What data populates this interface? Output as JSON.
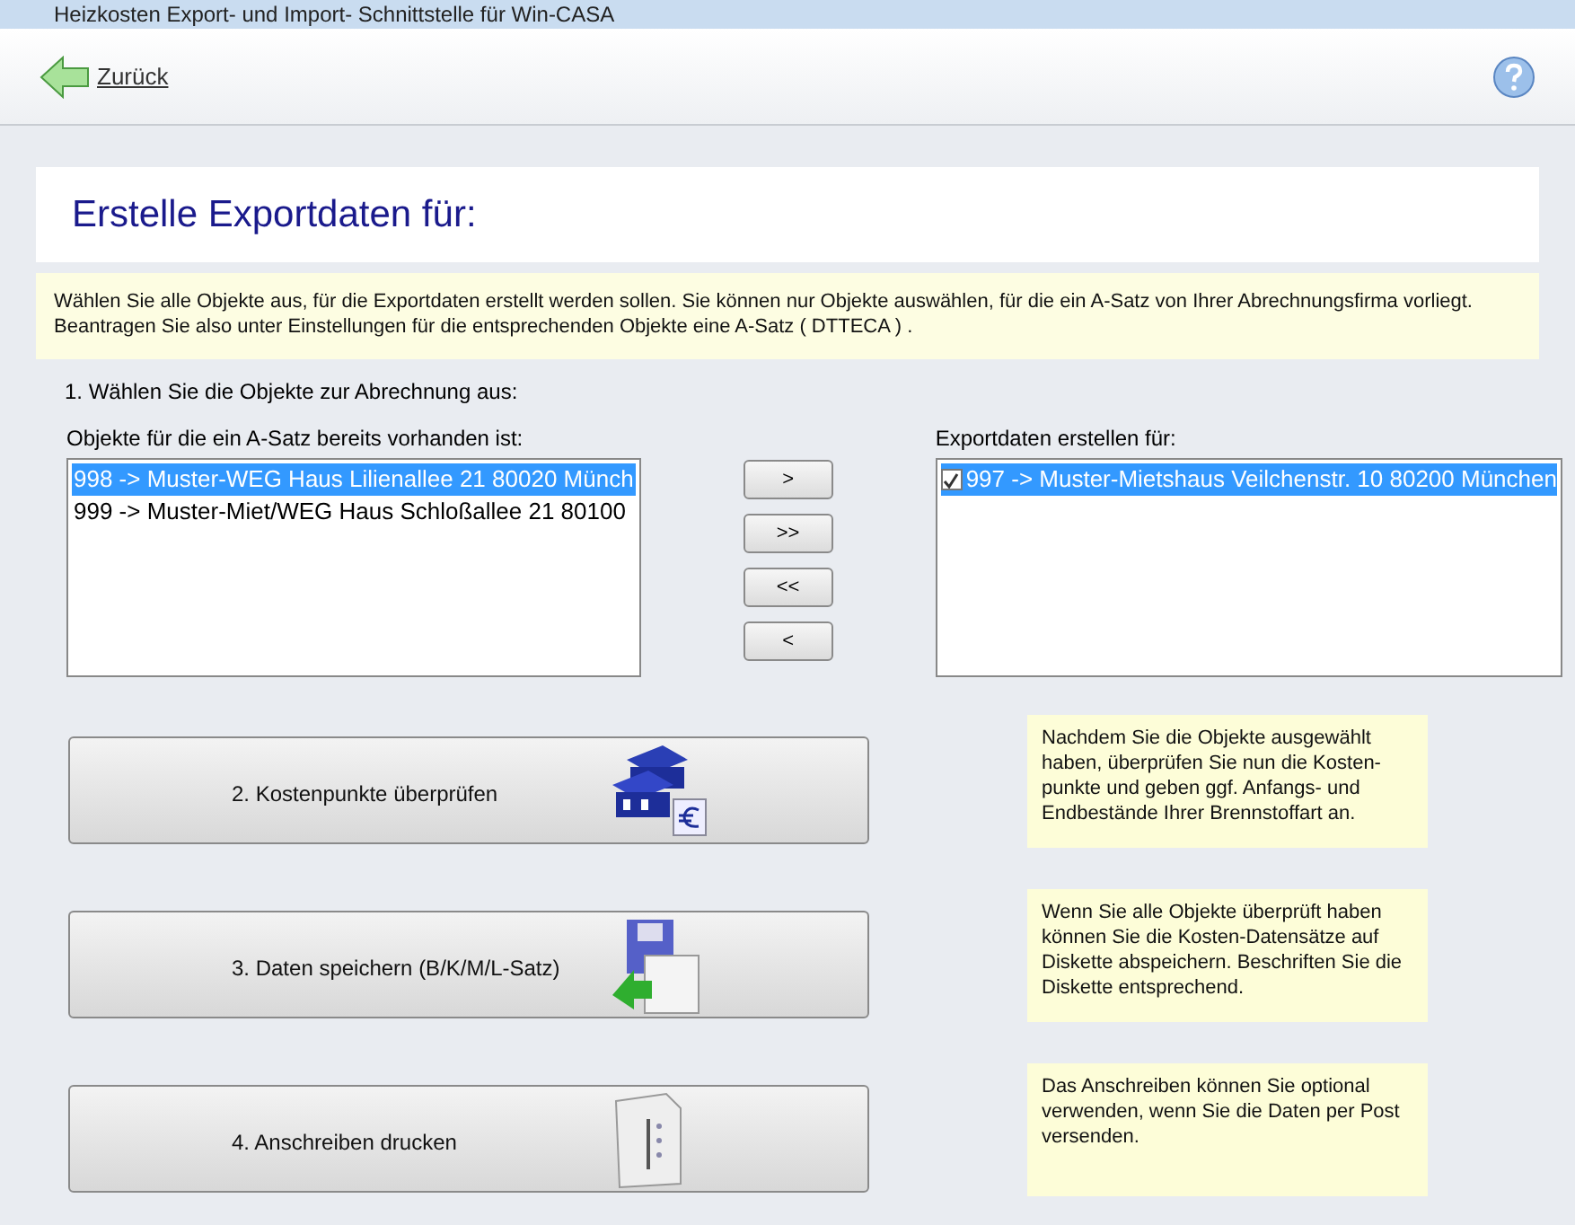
{
  "window": {
    "title": "Heizkosten Export- und Import- Schnittstelle für Win-CASA"
  },
  "toolbar": {
    "back": "Zurück"
  },
  "heading": "Erstelle Exportdaten für:",
  "info": "Wählen Sie alle Objekte aus, für die Exportdaten erstellt werden sollen. Sie können nur Objekte auswählen, für die ein A-Satz von Ihrer Abrechnungsfirma vorliegt. Beantragen Sie also unter Einstellungen für die entsprechenden Objekte eine A-Satz ( DTTECA ) .",
  "step1": "1. Wählen Sie die Objekte zur Abrechnung aus:",
  "available": {
    "label": "Objekte für die ein A-Satz bereits vorhanden ist:",
    "items": [
      {
        "text": "998 -> Muster-WEG Haus  Lilienallee 21   80020 Münch",
        "selected": true
      },
      {
        "text": "999 -> Muster-Miet/WEG Haus  Schloßallee 21   80100",
        "selected": false
      }
    ]
  },
  "move_buttons": [
    ">",
    ">>",
    "<<",
    "<"
  ],
  "export": {
    "label": "Exportdaten erstellen für:",
    "items": [
      {
        "text": "997 -> Muster-Mietshaus  Veilchenstr. 10   80200 München",
        "checked": true,
        "selected": true
      }
    ]
  },
  "steps": [
    {
      "kind": "costs",
      "label": "2. Kostenpunkte überprüfen",
      "note": "Nachdem Sie die Objekte ausgewählt haben, überprüfen Sie nun die Kosten-punkte und geben ggf. Anfangs- und Endbestände Ihrer Brennstoffart an."
    },
    {
      "kind": "save",
      "label": "3. Daten speichern (B/K/M/L-Satz)",
      "note": "Wenn Sie alle Objekte überprüft haben können Sie die Kosten-Datensätze auf Diskette abspeichern. Beschriften Sie die Diskette entsprechend."
    },
    {
      "kind": "print",
      "label": "4. Anschreiben drucken",
      "note": "Das Anschreiben können Sie optional verwenden, wenn Sie die Daten per Post versenden."
    }
  ]
}
